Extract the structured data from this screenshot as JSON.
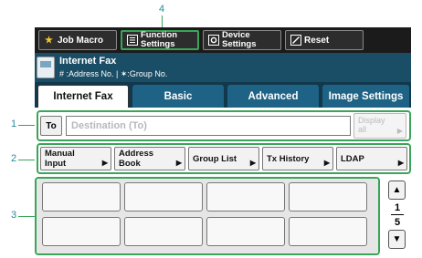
{
  "callouts": {
    "c1": "1",
    "c2": "2",
    "c3": "3",
    "c4": "4"
  },
  "topbar": {
    "job_macro": "Job Macro",
    "function_settings_l1": "Function",
    "function_settings_l2": "Settings",
    "device_settings_l1": "Device",
    "device_settings_l2": "Settings",
    "reset": "Reset"
  },
  "header": {
    "title": "Internet Fax",
    "subtitle": "# :Address No. | ✶:Group No."
  },
  "tabs": [
    "Internet Fax",
    "Basic",
    "Advanced",
    "Image Settings"
  ],
  "destination": {
    "to_label": "To",
    "placeholder": "Destination (To)",
    "display_all_l1": "Display",
    "display_all_l2": "all"
  },
  "sources": [
    {
      "l1": "Manual",
      "l2": "Input"
    },
    {
      "l1": "Address",
      "l2": "Book"
    },
    {
      "l1": "Group List",
      "l2": ""
    },
    {
      "l1": "Tx History",
      "l2": ""
    },
    {
      "l1": "LDAP",
      "l2": ""
    }
  ],
  "pager": {
    "current": "1",
    "total": "5"
  },
  "icons": {
    "job_macro": "star-icon",
    "function_settings": "list-icon",
    "device_settings": "gear-icon",
    "reset": "reset-icon",
    "scroll_up": "triangle-up-icon",
    "scroll_down": "triangle-down-icon"
  },
  "colors": {
    "highlight": "#3aa55a",
    "header_bg": "#1a4d66",
    "tab_bg": "#1e6285"
  }
}
